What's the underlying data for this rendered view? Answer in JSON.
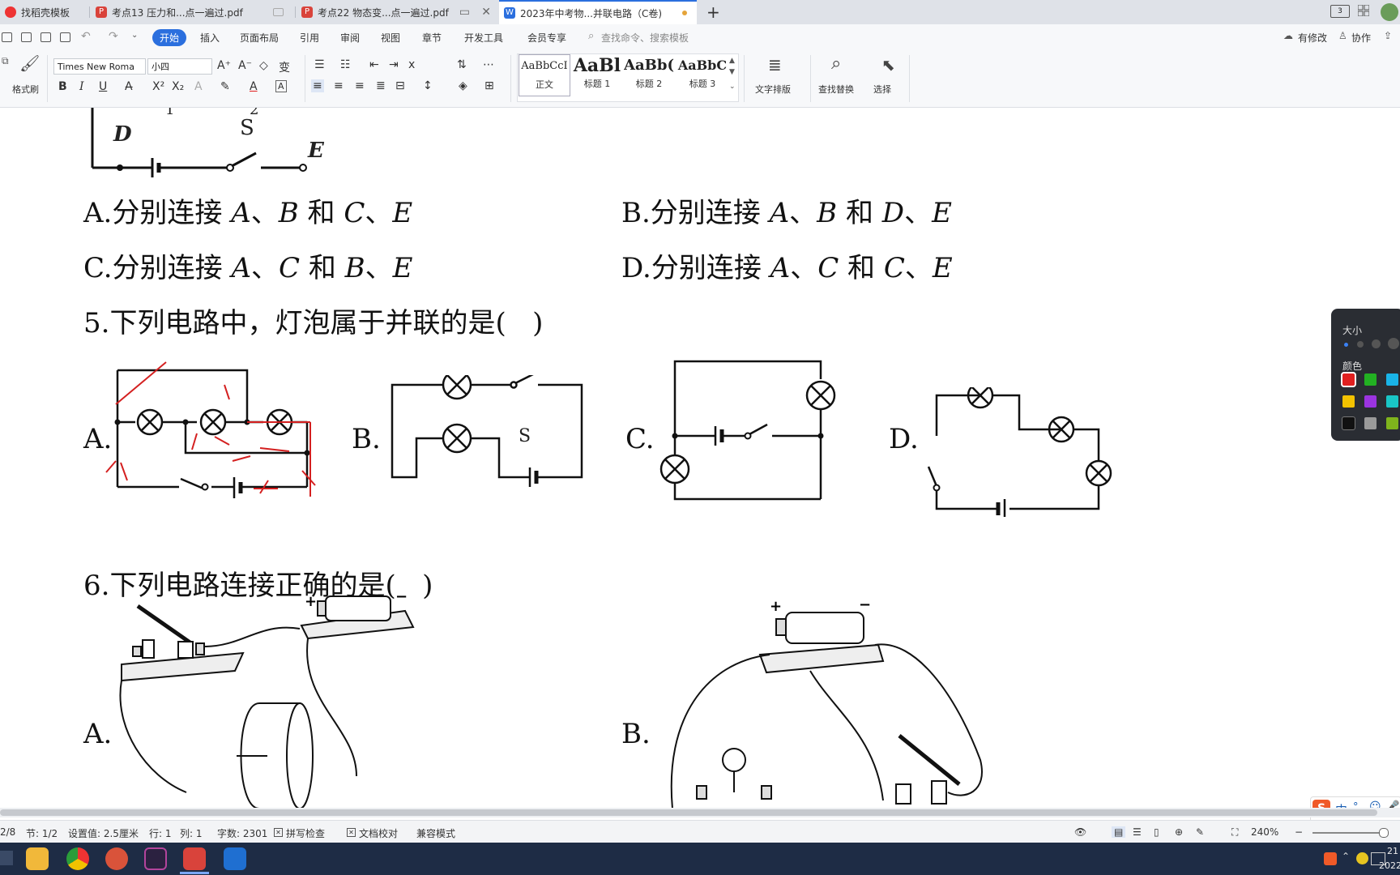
{
  "tabs": [
    {
      "label": "找稻壳模板",
      "icon": "wps-logo-icon"
    },
    {
      "label": "考点13 压力和...点一遍过.pdf",
      "icon": "pdf-icon"
    },
    {
      "label": "考点22 物态变...点一遍过.pdf",
      "icon": "pdf-icon"
    },
    {
      "label": "2023年中考物...并联电路（C卷)",
      "icon": "word-doc-icon",
      "active": true
    }
  ],
  "menu": {
    "items": [
      "开始",
      "插入",
      "页面布局",
      "引用",
      "审阅",
      "视图",
      "章节",
      "开发工具",
      "会员专享"
    ],
    "active": "开始",
    "search_placeholder": "查找命令、搜索模板",
    "right": [
      "有修改",
      "协作"
    ]
  },
  "ribbon": {
    "format_painter": "格式刷",
    "font_name": "Times New Roma",
    "font_size": "小四",
    "styles": [
      {
        "sample": "AaBbCcI",
        "name": "正文"
      },
      {
        "sample": "AaBl",
        "name": "标题 1"
      },
      {
        "sample": "AaBb(",
        "name": "标题 2"
      },
      {
        "sample": "AaBbC",
        "name": "标题 3"
      }
    ],
    "text_layout": "文字排版",
    "find_replace": "查找替换",
    "select": "选择"
  },
  "doc": {
    "q4_options": {
      "A": {
        "label": "A.",
        "text": "分别连接 ",
        "v1": "A",
        "s1": "、",
        "v2": "B",
        "mid": " 和 ",
        "v3": "C",
        "s2": "、",
        "v4": "E"
      },
      "B": {
        "label": "B.",
        "text": "分别连接 ",
        "v1": "A",
        "s1": "、",
        "v2": "B",
        "mid": " 和 ",
        "v3": "D",
        "s2": "、",
        "v4": "E"
      },
      "C": {
        "label": "C.",
        "text": "分别连接 ",
        "v1": "A",
        "s1": "、",
        "v2": "C",
        "mid": " 和 ",
        "v3": "B",
        "s2": "、",
        "v4": "E"
      },
      "D": {
        "label": "D.",
        "text": "分别连接 ",
        "v1": "A",
        "s1": "、",
        "v2": "C",
        "mid": " 和 ",
        "v3": "C",
        "s2": "、",
        "v4": "E"
      }
    },
    "circuit4_labels": {
      "d": "D",
      "s": "S",
      "e": "E",
      "sub1": "1",
      "sub2": "2"
    },
    "q5": {
      "text": "5.下列电路中，灯泡属于并联的是(",
      "close": ")",
      "options": [
        "A.",
        "B.",
        "C.",
        "D."
      ],
      "switch_label": "S"
    },
    "q6": {
      "text": "6.下列电路连接正确的是(",
      "close": ")",
      "options": [
        "A.",
        "B."
      ],
      "plus": "+",
      "minus": "−"
    }
  },
  "status": {
    "page": "2/8",
    "section": "节: 1/2",
    "setting": "设置值: 2.5厘米",
    "row": "行: 1",
    "col": "列: 1",
    "words": "字数: 2301",
    "spell": "拼写检查",
    "proof": "文档校对",
    "compat": "兼容模式",
    "zoom": "240%"
  },
  "pen_panel": {
    "size_label": "大小",
    "color_label": "颜色",
    "colors": [
      "#e02020",
      "#22b122",
      "#19b4e8",
      "#f2c200",
      "#9b34e0",
      "#19c6c6",
      "#111111",
      "#9a9a9a",
      "#7fb41c"
    ]
  },
  "ime": {
    "mode": "中"
  },
  "clock": {
    "time": "21",
    "date": "2022"
  }
}
